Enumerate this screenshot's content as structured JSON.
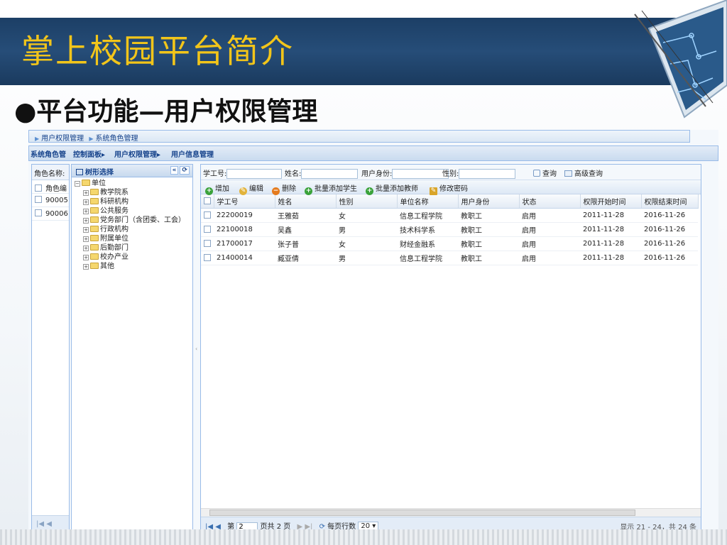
{
  "slide": {
    "title": "掌上校园平台简介",
    "subtitle": "●平台功能—用户权限管理"
  },
  "app": {
    "breadcrumb": [
      "用户权限管理",
      "系统角色管理"
    ],
    "tabs": [
      "系统角色管",
      "控制面板▸",
      "用户权限管理▸",
      "用户信息管理"
    ],
    "left_grid": {
      "label": "角色名称:",
      "header": "角色编",
      "rows": [
        "90005",
        "90006"
      ]
    },
    "tree": {
      "title": "树形选择",
      "root": "单位",
      "children": [
        "教学院系",
        "科研机构",
        "公共服务",
        "党务部门（含团委、工会）",
        "行政机构",
        "附属单位",
        "后勤部门",
        "校办产业",
        "其他"
      ]
    },
    "search": {
      "id_label": "学工号:",
      "name_label": "姓名:",
      "role_label": "用户身份:",
      "gender_label": "性别:",
      "query": "查询",
      "advanced": "高级查询"
    },
    "toolbar": {
      "add": "增加",
      "edit": "编辑",
      "delete": "删除",
      "batch_students": "批量添加学生",
      "batch_teachers": "批量添加教师",
      "change_password": "修改密码"
    },
    "columns": [
      "学工号",
      "姓名",
      "性别",
      "单位名称",
      "用户身份",
      "状态",
      "权限开始时间",
      "权限结束时间"
    ],
    "rows": [
      [
        "22200019",
        "王雅茹",
        "女",
        "信息工程学院",
        "教职工",
        "启用",
        "2011-11-28",
        "2016-11-26"
      ],
      [
        "22100018",
        "吴鑫",
        "男",
        "技术科学系",
        "教职工",
        "启用",
        "2011-11-28",
        "2016-11-26"
      ],
      [
        "21700017",
        "张子普",
        "女",
        "财经金融系",
        "教职工",
        "启用",
        "2011-11-28",
        "2016-11-26"
      ],
      [
        "21400014",
        "臧亚倩",
        "男",
        "信息工程学院",
        "教职工",
        "启用",
        "2011-11-28",
        "2016-11-26"
      ]
    ],
    "pager": {
      "page_prefix": "第",
      "page_value": "2",
      "page_suffix": "页共 2 页",
      "per_page_label": "每页行数",
      "per_page": "20",
      "summary": "显示 21 - 24，共 24 条"
    }
  },
  "colors": {
    "title_bar": "#1c3f66",
    "title_text": "#f2c51a",
    "panel_border": "#99bbe8",
    "panel_text": "#15428b"
  }
}
